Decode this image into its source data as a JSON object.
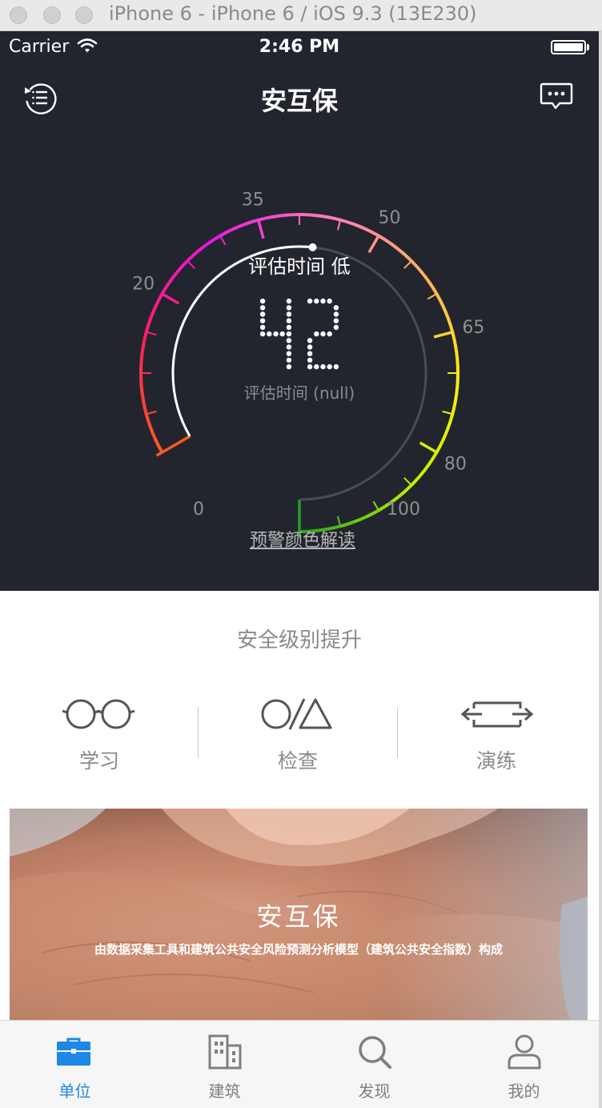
{
  "window": {
    "title": "iPhone 6 - iPhone 6 / iOS 9.3 (13E230)"
  },
  "status_bar": {
    "carrier": "Carrier",
    "time": "2:46 PM",
    "icons": [
      "wifi-icon",
      "battery-icon"
    ]
  },
  "nav": {
    "title": "安互保",
    "left_icon": "history-list-icon",
    "right_icon": "message-icon"
  },
  "gauge": {
    "value": 42,
    "min": 0,
    "max": 100,
    "level_text": "评估时间 低",
    "display_value": "42",
    "caption": "评估时间 (null)",
    "tick_labels": [
      "0",
      "20",
      "35",
      "50",
      "65",
      "80",
      "100"
    ],
    "colors": [
      "#ff5a1f",
      "#ff2060",
      "#e815e0",
      "#ff78c0",
      "#ffb060",
      "#ffee10",
      "#b8f000",
      "#22a022"
    ]
  },
  "warning_link": "预警颜色解读",
  "section": {
    "title": "安全级别提升",
    "features": [
      {
        "label": "学习",
        "icon": "glasses-icon"
      },
      {
        "label": "检查",
        "icon": "circle-triangle-icon"
      },
      {
        "label": "演练",
        "icon": "arrows-icon"
      }
    ]
  },
  "banner": {
    "title": "安互保",
    "subtitle": "由数据采集工具和建筑公共安全风险预测分析模型（建筑公共安全指数）构成"
  },
  "tabbar": {
    "active_color": "#1e88e5",
    "tabs": [
      {
        "label": "单位",
        "icon": "briefcase-icon",
        "active": true
      },
      {
        "label": "建筑",
        "icon": "building-icon",
        "active": false
      },
      {
        "label": "发现",
        "icon": "search-icon",
        "active": false
      },
      {
        "label": "我的",
        "icon": "user-icon",
        "active": false
      }
    ]
  }
}
